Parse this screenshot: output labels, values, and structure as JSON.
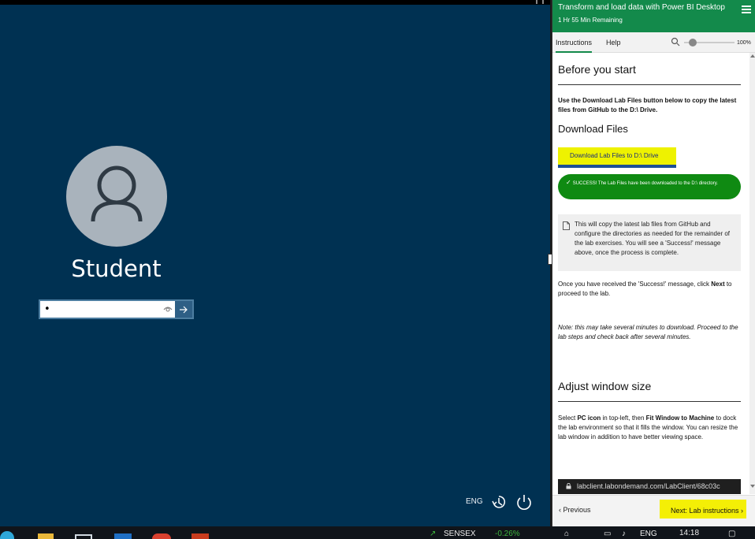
{
  "lock_screen": {
    "username": "Student",
    "password_value": "•",
    "language": "ENG"
  },
  "panel": {
    "title": "Transform and load data with Power BI Desktop",
    "time_remaining": "1 Hr 55 Min Remaining",
    "tabs": [
      {
        "label": "Instructions"
      },
      {
        "label": "Help"
      }
    ],
    "zoom_value": "100%",
    "section1_heading": "Before you start",
    "intro_text": "Use the Download Lab Files button below to copy the latest files from GitHub to the D:\\ Drive.",
    "download_heading": "Download Files",
    "download_button": "Download Lab Files to D:\\ Drive",
    "success_text": "SUCCESS! The Lab Files have been downloaded to the D:\\ directory.",
    "note_text": "This will copy the latest lab files from GitHub and configure the directories as needed for the remainder of the lab exercises. You will see a 'Success!' message above, once the process is complete.",
    "proceed_text_1": "Once you have received the 'Success!' message, click ",
    "proceed_bold": "Next",
    "proceed_text_2": " to proceed to the lab.",
    "italic_note": "Note: this may take several minutes to download. Proceed to the lab steps and check back after several minutes.",
    "section2_heading": "Adjust window size",
    "adjust_text_1": "Select ",
    "adjust_bold_1": "PC icon",
    "adjust_text_2": " in top-left, then ",
    "adjust_bold_2": "Fit Window to Machine",
    "adjust_text_3": " to dock the lab environment so that it fills the window. You can resize the lab window in addition to have better viewing space.",
    "url_text": "labclient.labondemand.com/LabClient/68c03c",
    "prev_label": "Previous",
    "next_label": "Next: Lab instructions"
  },
  "taskbar": {
    "ticker_name": "SENSEX",
    "ticker_change": "-0.26%",
    "language": "ENG",
    "time": "14:18"
  },
  "colors": {
    "lock_bg": "#003152",
    "panel_header": "#138a4b",
    "success_green": "#0f8a12",
    "highlight_yellow": "#f4ef06"
  }
}
